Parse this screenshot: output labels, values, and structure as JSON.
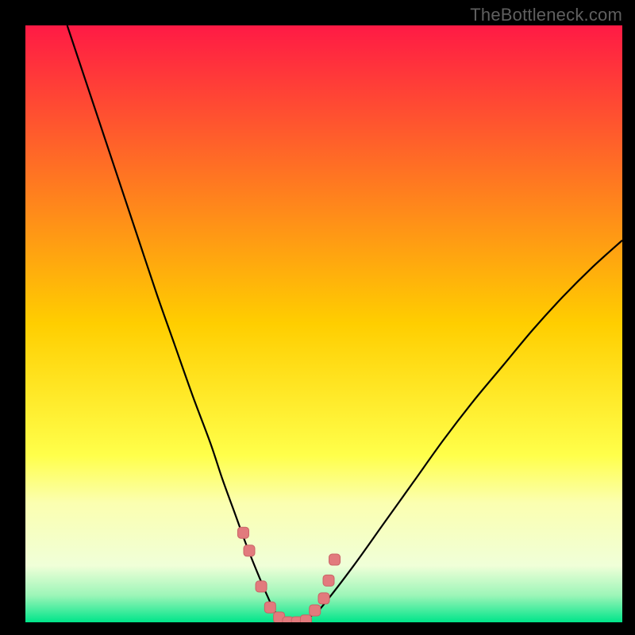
{
  "watermark": {
    "text": "TheBottleneck.com"
  },
  "colors": {
    "black": "#000000",
    "curve": "#000000",
    "marker_fill": "#e27a7d",
    "marker_stroke": "#c96366",
    "gradient_stops": [
      {
        "offset": 0.0,
        "color": "#ff1a45"
      },
      {
        "offset": 0.5,
        "color": "#ffce00"
      },
      {
        "offset": 0.72,
        "color": "#ffff4a"
      },
      {
        "offset": 0.8,
        "color": "#fbffb0"
      },
      {
        "offset": 0.905,
        "color": "#f0ffd8"
      },
      {
        "offset": 0.955,
        "color": "#9cf5b8"
      },
      {
        "offset": 1.0,
        "color": "#00e58a"
      }
    ]
  },
  "chart_data": {
    "type": "line",
    "title": "",
    "xlabel": "",
    "ylabel": "",
    "xlim": [
      0,
      100
    ],
    "ylim": [
      0,
      100
    ],
    "series": [
      {
        "name": "bottleneck-curve",
        "x": [
          7,
          10,
          13,
          16,
          19,
          22,
          25,
          28,
          31,
          33,
          35,
          37,
          39,
          40.5,
          42,
          44,
          46,
          48.5,
          50,
          55,
          60,
          65,
          70,
          75,
          80,
          85,
          90,
          95,
          100
        ],
        "y": [
          100,
          91,
          82,
          73,
          64,
          55,
          46.5,
          38,
          30,
          24,
          18.5,
          13,
          8,
          4.5,
          1.5,
          0,
          0,
          1.5,
          3,
          9.5,
          16.5,
          23.5,
          30.5,
          37,
          43,
          49,
          54.5,
          59.5,
          64
        ]
      }
    ],
    "markers": {
      "name": "highlight-points",
      "x": [
        36.5,
        37.5,
        39.5,
        41,
        42.5,
        44,
        45.5,
        47,
        48.5,
        50,
        50.8,
        51.8
      ],
      "y": [
        15,
        12,
        6,
        2.5,
        0.8,
        0,
        0,
        0.3,
        2,
        4,
        7,
        10.5
      ]
    }
  }
}
